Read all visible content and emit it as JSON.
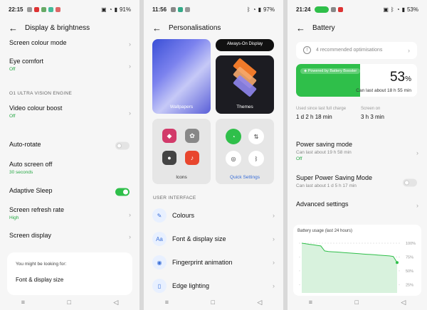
{
  "panel1": {
    "status": {
      "time": "22:15",
      "battery": "91%"
    },
    "header": {
      "title": "Display & brightness"
    },
    "rows": {
      "screen_colour_mode": "Screen colour mode",
      "eye_comfort": "Eye comfort",
      "eye_comfort_sub": "Off",
      "section_engine": "O1 ULTRA VISION ENGINE",
      "video_colour_boost": "Video colour boost",
      "video_colour_boost_sub": "Off",
      "auto_rotate": "Auto-rotate",
      "auto_screen_off": "Auto screen off",
      "auto_screen_off_sub": "30 seconds",
      "adaptive_sleep": "Adaptive Sleep",
      "screen_refresh_rate": "Screen refresh rate",
      "screen_refresh_rate_sub": "High",
      "screen_display": "Screen display"
    },
    "suggestion": {
      "title": "You might be looking for:",
      "item": "Font & display size"
    }
  },
  "panel2": {
    "status": {
      "time": "11:56",
      "battery": "97%"
    },
    "header": {
      "title": "Personalisations"
    },
    "tiles": {
      "always_on": "Always-On Display",
      "wallpapers": "Wallpapers",
      "themes": "Themes",
      "icons": "Icons",
      "quick_settings": "Quick Settings"
    },
    "section": "USER INTERFACE",
    "list": [
      "Colours",
      "Font & display size",
      "Fingerprint animation",
      "Edge lighting"
    ]
  },
  "panel3": {
    "status": {
      "time": "21:24",
      "battery": "53%"
    },
    "header": {
      "title": "Battery"
    },
    "recommend": "4 recommended optimisations",
    "booster": "Powered by Battery Booster",
    "percent": "53",
    "percent_unit": "%",
    "level": 0.53,
    "can_last": "Can last about 18 h 55 min",
    "used_since_label": "Used since last full charge",
    "used_since_value": "1 d 2 h 18 min",
    "screen_on_label": "Screen on",
    "screen_on_value": "3 h 3 min",
    "power_saving": {
      "title": "Power saving mode",
      "sub1": "Can last about 19 h 58 min",
      "sub2": "Off"
    },
    "super_saving": {
      "title": "Super Power Saving Mode",
      "sub": "Can last about 1 d 5 h 17 min"
    },
    "advanced": "Advanced settings",
    "usage_title": "Battery usage (last 24 hours)",
    "usage_ticks": [
      "100%",
      "75%",
      "50%",
      "25%"
    ],
    "usage_points": [
      100,
      99,
      98,
      97,
      96,
      95,
      86,
      85,
      84.5,
      84,
      83.5,
      83,
      82.5,
      82,
      81.5,
      81,
      80.5,
      80,
      79.5,
      79,
      78.5,
      78,
      77.5,
      77,
      76,
      65
    ],
    "accent": "#2fbf4a"
  }
}
